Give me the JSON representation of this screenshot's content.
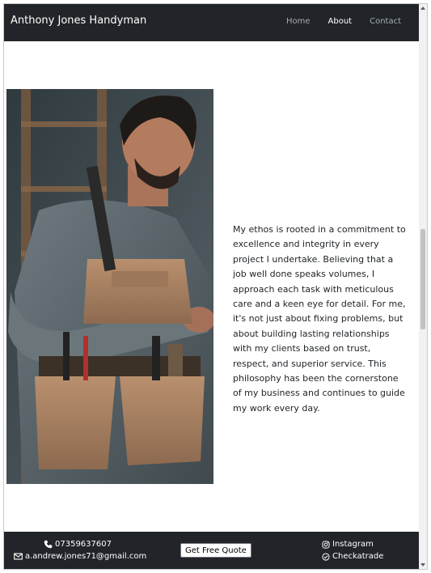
{
  "navbar": {
    "brand": "Anthony Jones Handyman",
    "links": [
      {
        "label": "Home",
        "active": false
      },
      {
        "label": "About",
        "active": true
      },
      {
        "label": "Contact",
        "active": false
      }
    ]
  },
  "about": {
    "image_icon": "handyman-portrait",
    "text": "My ethos is rooted in a commitment to excellence and integrity in every project I undertake. Believing that a job well done speaks volumes, I approach each task with meticulous care and a keen eye for detail. For me, it's not just about fixing problems, but about building lasting relationships with my clients based on trust, respect, and superior service. This philosophy has been the cornerstone of my business and continues to guide my work every day."
  },
  "footer": {
    "phone": "07359637607",
    "email": "a.andrew.jones71@gmail.com",
    "quote_button": "Get Free Quote",
    "instagram": "Instagram",
    "checkatrade": "Checkatrade",
    "icons": {
      "phone": "phone-icon",
      "email": "envelope-icon",
      "instagram": "instagram-icon",
      "checkatrade": "check-circle-icon"
    }
  },
  "colors": {
    "navbar_bg": "#212529",
    "footer_bg": "#212529",
    "nav_inactive": "#a8acb0",
    "nav_active": "#ffffff",
    "body_text": "#212529"
  }
}
